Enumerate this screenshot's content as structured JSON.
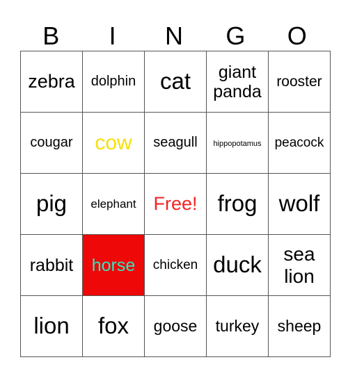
{
  "header": {
    "letters": [
      "B",
      "I",
      "N",
      "G",
      "O"
    ]
  },
  "card": {
    "rows": [
      [
        {
          "text": "zebra",
          "size": 27,
          "color": "#000000",
          "bg": "#ffffff"
        },
        {
          "text": "dolphin",
          "size": 20,
          "color": "#000000",
          "bg": "#ffffff"
        },
        {
          "text": "cat",
          "size": 33,
          "color": "#000000",
          "bg": "#ffffff"
        },
        {
          "text": "giant panda",
          "size": 25,
          "color": "#000000",
          "bg": "#ffffff"
        },
        {
          "text": "rooster",
          "size": 21,
          "color": "#000000",
          "bg": "#ffffff"
        }
      ],
      [
        {
          "text": "cougar",
          "size": 20,
          "color": "#000000",
          "bg": "#ffffff"
        },
        {
          "text": "cow",
          "size": 30,
          "color": "#f5e10a",
          "bg": "#ffffff"
        },
        {
          "text": "seagull",
          "size": 20,
          "color": "#000000",
          "bg": "#ffffff"
        },
        {
          "text": "hippopotamus",
          "size": 11,
          "color": "#000000",
          "bg": "#ffffff"
        },
        {
          "text": "peacock",
          "size": 19,
          "color": "#000000",
          "bg": "#ffffff"
        }
      ],
      [
        {
          "text": "pig",
          "size": 33,
          "color": "#000000",
          "bg": "#ffffff"
        },
        {
          "text": "elephant",
          "size": 17,
          "color": "#000000",
          "bg": "#ffffff"
        },
        {
          "text": "Free!",
          "size": 27,
          "color": "#f02424",
          "bg": "#ffffff"
        },
        {
          "text": "frog",
          "size": 33,
          "color": "#000000",
          "bg": "#ffffff"
        },
        {
          "text": "wolf",
          "size": 33,
          "color": "#000000",
          "bg": "#ffffff"
        }
      ],
      [
        {
          "text": "rabbit",
          "size": 25,
          "color": "#000000",
          "bg": "#ffffff"
        },
        {
          "text": "horse",
          "size": 25,
          "color": "#2de8c4",
          "bg": "#ee0808"
        },
        {
          "text": "chicken",
          "size": 19,
          "color": "#000000",
          "bg": "#ffffff"
        },
        {
          "text": "duck",
          "size": 33,
          "color": "#000000",
          "bg": "#ffffff"
        },
        {
          "text": "sea lion",
          "size": 28,
          "color": "#000000",
          "bg": "#ffffff"
        }
      ],
      [
        {
          "text": "lion",
          "size": 33,
          "color": "#000000",
          "bg": "#ffffff"
        },
        {
          "text": "fox",
          "size": 33,
          "color": "#000000",
          "bg": "#ffffff"
        },
        {
          "text": "goose",
          "size": 23,
          "color": "#000000",
          "bg": "#ffffff"
        },
        {
          "text": "turkey",
          "size": 23,
          "color": "#000000",
          "bg": "#ffffff"
        },
        {
          "text": "sheep",
          "size": 23,
          "color": "#000000",
          "bg": "#ffffff"
        }
      ]
    ]
  }
}
